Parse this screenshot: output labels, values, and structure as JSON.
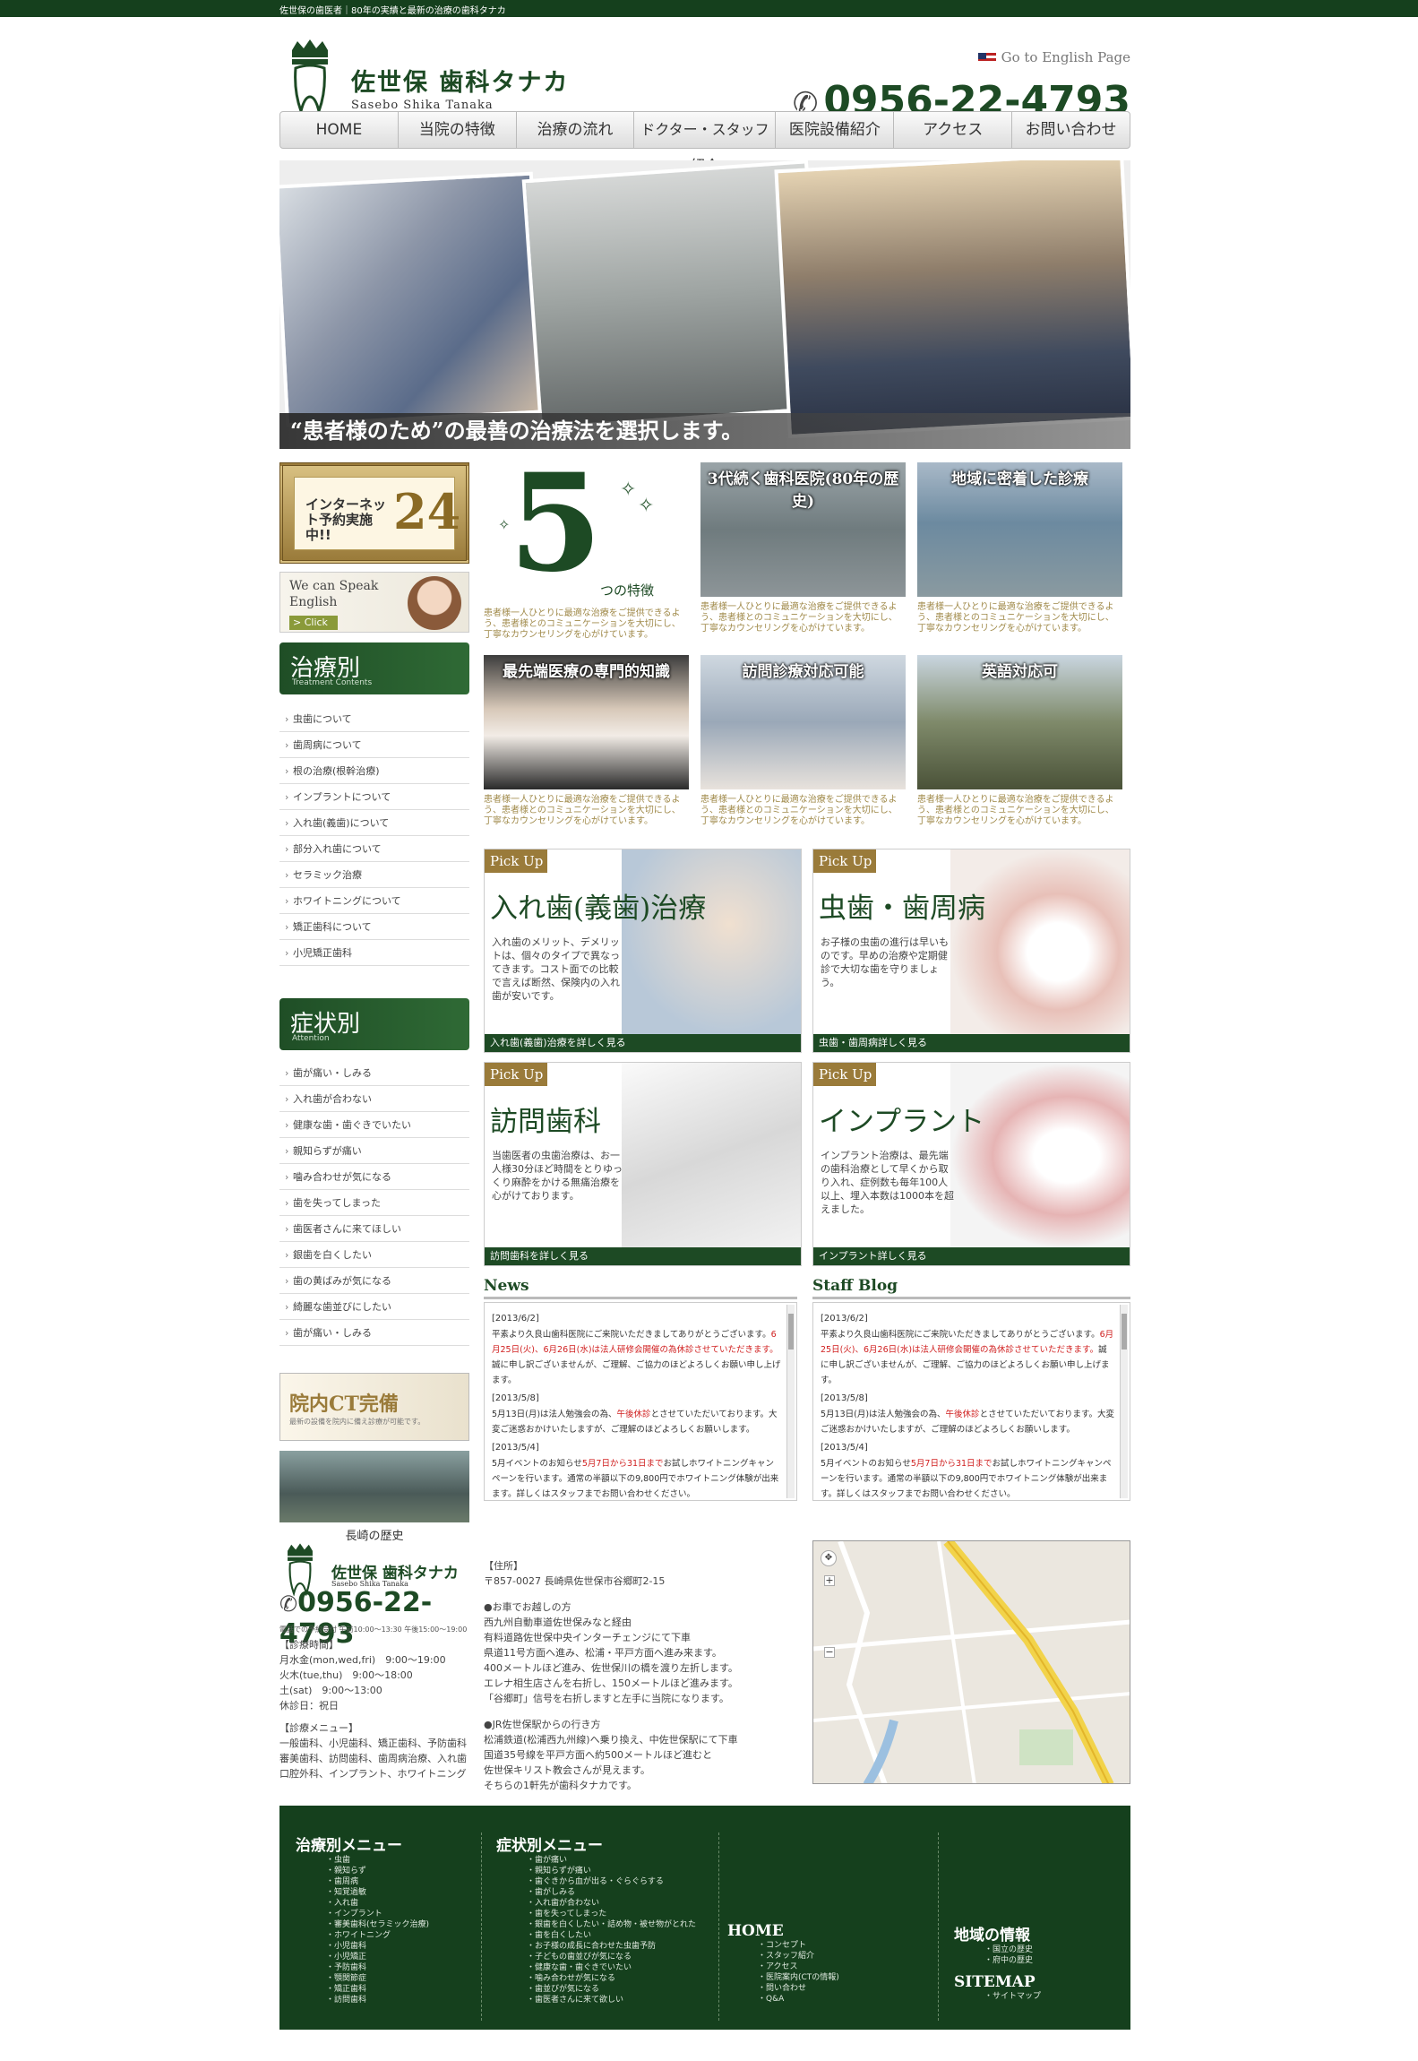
{
  "topbar": {
    "text": "佐世保の歯医者｜80年の実績と最新の治療の歯科タナカ"
  },
  "header": {
    "logo_ja": "佐世保 歯科タナカ",
    "logo_en": "Sasebo Shika Tanaka",
    "english_link": "Go to English Page",
    "tel": "0956-22-4793"
  },
  "nav": [
    "HOME",
    "当院の特徴",
    "治療の流れ",
    "ドクター・スタッフ紹介",
    "医院設備紹介",
    "アクセス",
    "お問い合わせ"
  ],
  "hero": {
    "caption": "“患者様のため”の最善の治療法を選択します。"
  },
  "sidebar": {
    "banner24_text": "インターネット予約実施中!!",
    "banner24_num": "24",
    "speak_text": "We can Speak English",
    "speak_click": "> Click",
    "treat_head": "治療別",
    "treat_sub": "Treatment Contents",
    "treat_items": [
      "虫歯について",
      "歯周病について",
      "根の治療(根幹治療)",
      "インプラントについて",
      "入れ歯(義歯)について",
      "部分入れ歯について",
      "セラミック治療",
      "ホワイトニングについて",
      "矯正歯科について",
      "小児矯正歯科"
    ],
    "sym_head": "症状別",
    "sym_sub": "Attention",
    "sym_items": [
      "歯が痛い・しみる",
      "入れ歯が合わない",
      "健康な歯・歯ぐきでいたい",
      "親知らずが痛い",
      "噛み合わせが気になる",
      "歯を失ってしまった",
      "歯医者さんに来てほしい",
      "銀歯を白くしたい",
      "歯の黄ばみが気になる",
      "綺麗な歯並びにしたい",
      "歯が痛い・しみる"
    ],
    "ct_title": "院内CT完備",
    "ct_sub": "最新の設備を院内に備え診療が可能です。",
    "history_caption": "長崎の歴史"
  },
  "five": {
    "num": "5",
    "label": "つの特徴"
  },
  "features": [
    {
      "title": "3代続く歯科医院(80年の歴史)",
      "text": "患者様一人ひとりに最適な治療をご提供できるよう、患者様とのコミュニケーションを大切にし、丁寧なカウンセリングを心がけています。"
    },
    {
      "title": "地域に密着した診療",
      "text": "患者様一人ひとりに最適な治療をご提供できるよう、患者様とのコミュニケーションを大切にし、丁寧なカウンセリングを心がけています。"
    },
    {
      "title": "最先端医療の専門的知識",
      "text": "患者様一人ひとりに最適な治療をご提供できるよう、患者様とのコミュニケーションを大切にし、丁寧なカウンセリングを心がけています。"
    },
    {
      "title": "訪問診療対応可能",
      "text": "患者様一人ひとりに最適な治療をご提供できるよう、患者様とのコミュニケーションを大切にし、丁寧なカウンセリングを心がけています。"
    },
    {
      "title": "英語対応可",
      "text": "患者様一人ひとりに最適な治療をご提供できるよう、患者様とのコミュニケーションを大切にし、丁寧なカウンセリングを心がけています。"
    }
  ],
  "five_text": "患者様一人ひとりに最適な治療をご提供できるよう、患者様とのコミュニケーションを大切にし、丁寧なカウンセリングを心がけています。",
  "pickups": [
    {
      "tag": "Pick Up",
      "title": "入れ歯(義歯)治療",
      "text": "入れ歯のメリット、デメリットは、個々のタイプで異なってきます。コスト面での比較で言えば断然、保険内の入れ歯が安いです。",
      "link": "入れ歯(義歯)治療を詳しく見る"
    },
    {
      "tag": "Pick Up",
      "title": "虫歯・歯周病",
      "text": "お子様の虫歯の進行は早いものです。早めの治療や定期健診で大切な歯を守りましょう。",
      "link": "虫歯・歯周病詳しく見る"
    },
    {
      "tag": "Pick Up",
      "title": "訪問歯科",
      "text": "当歯医者の虫歯治療は、お一人様30分ほど時間をとりゆっくり麻酔をかける無痛治療を心がけております。",
      "link": "訪問歯科を詳しく見る"
    },
    {
      "tag": "Pick Up",
      "title": "インプラント",
      "text": "インプラント治療は、最先端の歯科治療として早くから取り入れ、症例数も毎年100人以上、埋入本数は1000本を超えました。",
      "link": "インプラント詳しく見る"
    }
  ],
  "news": {
    "head": "News",
    "items": [
      {
        "date": "[2013/6/2]",
        "text": "平素より久良山歯科医院にご来院いただきましてありがとうございます。",
        "red": "6月25日(火)、6月26日(水)は法人研修会開催の為休診させていただきます。",
        "after": "誠に申し訳ございませんが、ご理解、ご協力のほどよろしくお願い申し上げます。"
      },
      {
        "date": "[2013/5/8]",
        "text": "5月13日(月)は法人勉強会の為、",
        "red": "午後休診",
        "after": "とさせていただいております。大変ご迷惑おかけいたしますが、ご理解のほどよろしくお願いします。"
      },
      {
        "date": "[2013/5/4]",
        "text": "5月イベントのお知らせ",
        "red": "5月7日から31日まで",
        "after": "お試しホワイトニングキャンペーンを行います。通常の半額以下の9,800円でホワイトニング体験が出来ます。詳しくはスタッフまでお問い合わせください。"
      }
    ]
  },
  "blog": {
    "head": "Staff Blog"
  },
  "footer_info": {
    "logo_ja": "佐世保 歯科タナカ",
    "logo_en": "Sasebo Shika Tanaka",
    "tel": "0956-22-4793",
    "tel_note": "電話での予約受付 午前10:00～13:30 午後15:00～19:00",
    "hours_head": "【診療時間】",
    "hours": [
      "月水金(mon,wed,fri)　9:00～19:00",
      "火木(tue,thu)　9:00～18:00",
      "土(sat)　9:00～13:00",
      "休診日：祝日"
    ],
    "menu_head": "【診療メニュー】",
    "menu": "一般歯科、小児歯科、矯正歯科、予防歯科審美歯科、訪問歯科、歯周病治療、入れ歯口腔外科、インプラント、ホワイトニング",
    "addr_head": "【住所】",
    "addr": "〒857-0027 長崎県佐世保市谷郷町2-15",
    "car_head": "●お車でお越しの方",
    "car": [
      "西九州自動車道佐世保みなと経由",
      "有料道路佐世保中央インターチェンジにて下車",
      "県道11号方面へ進み、松浦・平戸方面へ進み来ます。",
      "400メートルほど進み、佐世保川の橋を渡り左折します。",
      "エレナ相生店さんを右折し、150メートルほど進みます。",
      "「谷郷町」信号を右折しますと左手に当院になります。"
    ],
    "jr_head": "●JR佐世保駅からの行き方",
    "jr": [
      "松浦鉄道(松浦西九州線)へ乗り換え、中佐世保駅にて下車",
      "国道35号線を平戸方面へ約500メートルほど進むと",
      "佐世保キリスト教会さんが見えます。",
      "そちらの1軒先が歯科タナカです。"
    ]
  },
  "fnav": {
    "treat_head": "治療別メニュー",
    "treat": [
      "虫歯",
      "親知らず",
      "歯周病",
      "知覚過敏",
      "入れ歯",
      "インプラント",
      "審美歯科(セラミック治療)",
      "ホワイトニング",
      "小児歯科",
      "小児矯正",
      "予防歯科",
      "顎関節症",
      "矯正歯科",
      "訪問歯科"
    ],
    "sym_head": "症状別メニュー",
    "sym": [
      "歯が痛い",
      "親知らずが痛い",
      "歯ぐきから血が出る・ぐらぐらする",
      "歯がしみる",
      "入れ歯が合わない",
      "歯を失ってしまった",
      "銀歯を白くしたい・詰め物・被せ物がとれた",
      "歯を白くしたい",
      "お子様の成長に合わせた虫歯予防",
      "子どもの歯並びが気になる",
      "健康な歯・歯ぐきでいたい",
      "噛み合わせが気になる",
      "歯並びが気になる",
      "歯医者さんに来て欲しい"
    ],
    "home_head": "HOME",
    "home": [
      "コンセプト",
      "スタッフ紹介",
      "アクセス",
      "医院案内(CTの情報)",
      "問い合わせ",
      "Q&A"
    ],
    "local_head": "地域の情報",
    "local": [
      "国立の歴史",
      "府中の歴史"
    ],
    "sitemap_head": "SITEMAP",
    "sitemap": [
      "サイトマップ"
    ]
  },
  "colors": {
    "brand_green": "#15401d",
    "gold": "#9a7b3a",
    "accent_red": "#d02020"
  }
}
